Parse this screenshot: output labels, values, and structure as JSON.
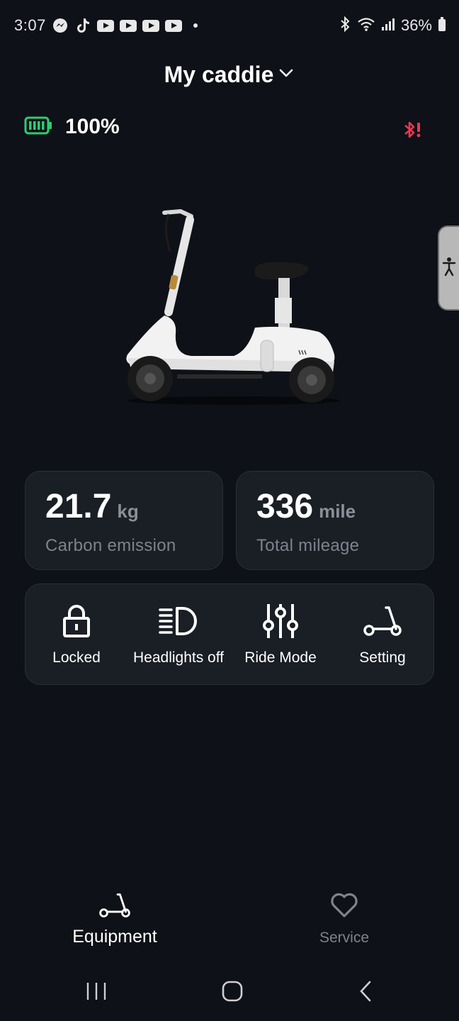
{
  "status_bar": {
    "time": "3:07",
    "battery_percent": "36%",
    "notification_icons": [
      "messenger-icon",
      "tiktok-icon",
      "youtube-icon",
      "youtube-icon",
      "youtube-icon",
      "youtube-icon"
    ]
  },
  "header": {
    "title": "My caddie"
  },
  "vehicle": {
    "battery_level": "100%",
    "bluetooth_status": "disconnected"
  },
  "stats": [
    {
      "value": "21.7",
      "unit": "kg",
      "label": "Carbon emission"
    },
    {
      "value": "336",
      "unit": "mile",
      "label": "Total mileage"
    }
  ],
  "controls": [
    {
      "label": "Locked",
      "icon": "lock-icon"
    },
    {
      "label": "Headlights off",
      "icon": "headlight-icon"
    },
    {
      "label": "Ride Mode",
      "icon": "sliders-icon"
    },
    {
      "label": "Setting",
      "icon": "scooter-icon"
    }
  ],
  "bottom_nav": {
    "items": [
      {
        "label": "Equipment",
        "icon": "scooter-icon",
        "active": true
      },
      {
        "label": "Service",
        "icon": "heart-icon",
        "active": false
      }
    ]
  },
  "colors": {
    "background": "#0e1117",
    "card": "#1a1e25",
    "battery_green": "#2ecc71",
    "alert_red": "#e8384f"
  }
}
